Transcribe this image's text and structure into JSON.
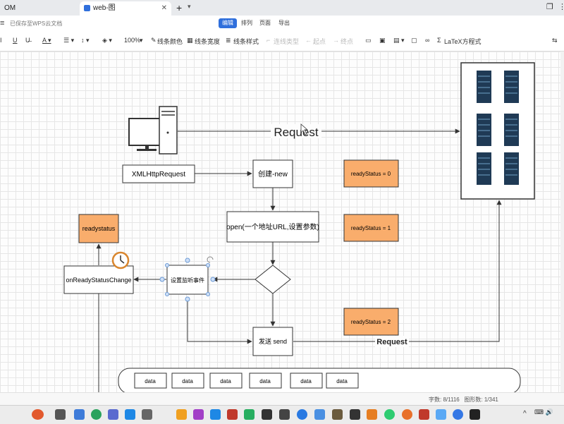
{
  "browser": {
    "tabs": [
      {
        "label": "OM"
      },
      {
        "label": "web-图"
      }
    ],
    "new_tab": "+"
  },
  "menubar": {
    "save_status": "已保存至WPS云文档",
    "tabs": [
      {
        "label": "编辑",
        "selected": true
      },
      {
        "label": "排列"
      },
      {
        "label": "页面"
      },
      {
        "label": "导出"
      }
    ]
  },
  "toolbar": {
    "zoom": "100%",
    "line_color": "线条颜色",
    "line_width": "线条宽度",
    "line_style": "线条样式",
    "connector_type": "连线类型",
    "start_point": "起点",
    "end_point": "终点",
    "latex": "LaTeX方程式"
  },
  "diagram": {
    "request_top": "Request",
    "request_bottom": "Request",
    "xmlhttp": "XMLHttpRequest",
    "create_new": "创建-new",
    "open": "open(一个地址URL,设置参数)",
    "listen": "设置监听事件",
    "on_change": "onReadyStatusChange",
    "readystatus": "readystatus",
    "send": "发送 send",
    "status0": "readyStatus = 0",
    "status1": "readyStatus = 1",
    "status2": "readyStatus = 2",
    "data_items": [
      "data",
      "data",
      "data",
      "data",
      "data",
      "data"
    ]
  },
  "status_bar": {
    "word_count": "字数: 8/1116",
    "shape_count": "图形数: 1/341"
  },
  "colors": {
    "orange": "#f9ad6c",
    "accent": "#2f6fdc",
    "server": "#1f3a55"
  }
}
